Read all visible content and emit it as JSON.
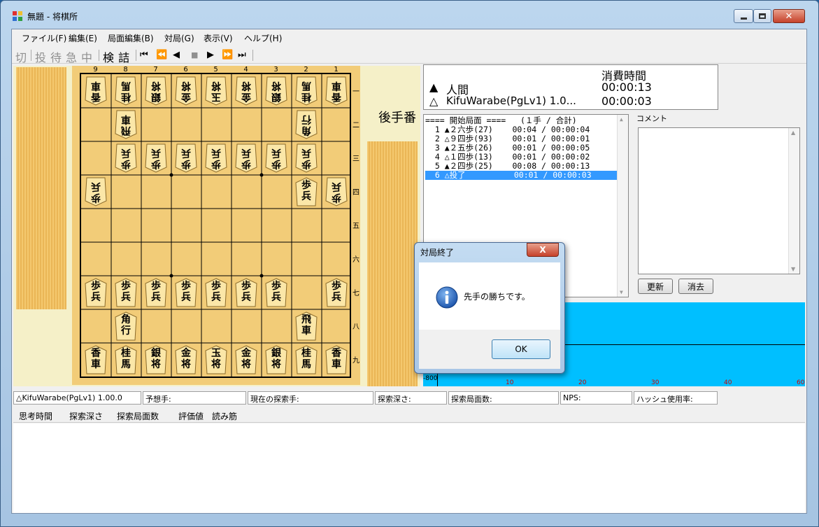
{
  "window": {
    "title": "無題 - 将棋所"
  },
  "menu": [
    "ファイル(F)",
    "編集(E)",
    "局面編集(B)",
    "対局(G)",
    "表示(V)",
    "ヘルプ(H)"
  ],
  "toolbar": {
    "items": [
      "切",
      "投",
      "待",
      "急",
      "中",
      "検",
      "詰"
    ],
    "nav": [
      "⏮",
      "⏪",
      "◀",
      "■",
      "▶",
      "⏩",
      "⏭"
    ]
  },
  "board": {
    "col_numbers": [
      "9",
      "8",
      "7",
      "6",
      "5",
      "4",
      "3",
      "2",
      "1"
    ],
    "row_numbers": [
      "一",
      "二",
      "三",
      "四",
      "五",
      "六",
      "七",
      "八",
      "九"
    ],
    "pieces": [
      {
        "r": 0,
        "c": 0,
        "t": "香車",
        "g": true
      },
      {
        "r": 0,
        "c": 1,
        "t": "桂馬",
        "g": true
      },
      {
        "r": 0,
        "c": 2,
        "t": "銀将",
        "g": true
      },
      {
        "r": 0,
        "c": 3,
        "t": "金将",
        "g": true
      },
      {
        "r": 0,
        "c": 4,
        "t": "玉将",
        "g": true
      },
      {
        "r": 0,
        "c": 5,
        "t": "金将",
        "g": true
      },
      {
        "r": 0,
        "c": 6,
        "t": "銀将",
        "g": true
      },
      {
        "r": 0,
        "c": 7,
        "t": "桂馬",
        "g": true
      },
      {
        "r": 0,
        "c": 8,
        "t": "香車",
        "g": true
      },
      {
        "r": 1,
        "c": 1,
        "t": "飛車",
        "g": true
      },
      {
        "r": 1,
        "c": 7,
        "t": "角行",
        "g": true
      },
      {
        "r": 2,
        "c": 1,
        "t": "歩兵",
        "g": true
      },
      {
        "r": 2,
        "c": 2,
        "t": "歩兵",
        "g": true
      },
      {
        "r": 2,
        "c": 3,
        "t": "歩兵",
        "g": true
      },
      {
        "r": 2,
        "c": 4,
        "t": "歩兵",
        "g": true
      },
      {
        "r": 2,
        "c": 5,
        "t": "歩兵",
        "g": true
      },
      {
        "r": 2,
        "c": 6,
        "t": "歩兵",
        "g": true
      },
      {
        "r": 2,
        "c": 7,
        "t": "歩兵",
        "g": true
      },
      {
        "r": 3,
        "c": 0,
        "t": "歩兵",
        "g": true
      },
      {
        "r": 3,
        "c": 7,
        "t": "歩兵",
        "g": false
      },
      {
        "r": 3,
        "c": 8,
        "t": "歩兵",
        "g": true
      },
      {
        "r": 6,
        "c": 0,
        "t": "歩兵",
        "g": false
      },
      {
        "r": 6,
        "c": 1,
        "t": "歩兵",
        "g": false
      },
      {
        "r": 6,
        "c": 2,
        "t": "歩兵",
        "g": false
      },
      {
        "r": 6,
        "c": 3,
        "t": "歩兵",
        "g": false
      },
      {
        "r": 6,
        "c": 4,
        "t": "歩兵",
        "g": false
      },
      {
        "r": 6,
        "c": 5,
        "t": "歩兵",
        "g": false
      },
      {
        "r": 6,
        "c": 6,
        "t": "歩兵",
        "g": false
      },
      {
        "r": 6,
        "c": 8,
        "t": "歩兵",
        "g": false
      },
      {
        "r": 7,
        "c": 1,
        "t": "角行",
        "g": false
      },
      {
        "r": 7,
        "c": 7,
        "t": "飛車",
        "g": false
      },
      {
        "r": 8,
        "c": 0,
        "t": "香車",
        "g": false
      },
      {
        "r": 8,
        "c": 1,
        "t": "桂馬",
        "g": false
      },
      {
        "r": 8,
        "c": 2,
        "t": "銀将",
        "g": false
      },
      {
        "r": 8,
        "c": 3,
        "t": "金将",
        "g": false
      },
      {
        "r": 8,
        "c": 4,
        "t": "玉将",
        "g": false
      },
      {
        "r": 8,
        "c": 5,
        "t": "金将",
        "g": false
      },
      {
        "r": 8,
        "c": 6,
        "t": "銀将",
        "g": false
      },
      {
        "r": 8,
        "c": 7,
        "t": "桂馬",
        "g": false
      },
      {
        "r": 8,
        "c": 8,
        "t": "香車",
        "g": false
      }
    ],
    "turn_label": "後手番"
  },
  "time": {
    "header": "消費時間",
    "sente": {
      "mark": "▲",
      "name": "人間",
      "time": "00:00:13"
    },
    "gote": {
      "mark": "△",
      "name": "KifuWarabe(PgLv1) 1.0...",
      "time": "00:00:03"
    }
  },
  "kifu": {
    "header": "==== 開始局面 ====   (１手 / 合計)",
    "moves": [
      "  1 ▲２六歩(27)    00:04 / 00:00:04",
      "  2 △９四歩(93)    00:01 / 00:00:01",
      "  3 ▲２五歩(26)    00:01 / 00:00:05",
      "  4 △１四歩(13)    00:01 / 00:00:02",
      "  5 ▲２四歩(25)    00:08 / 00:00:13",
      "  6 △投了          00:01 / 00:00:03"
    ],
    "selected_index": 5
  },
  "comment": {
    "label": "コメント",
    "update_button": "更新",
    "clear_button": "消去"
  },
  "graph": {
    "ticks": [
      "-800",
      "10",
      "20",
      "30",
      "40",
      "60"
    ]
  },
  "status": {
    "engine": "△KifuWarabe(PgLv1) 1.00.0",
    "predict": "予想手:",
    "current": "現在の探索手:",
    "depth": "探索深さ:",
    "nodes": "探索局面数:",
    "nps": "NPS:",
    "hash": "ハッシュ使用率:"
  },
  "think": {
    "headers": [
      "思考時間",
      "探索深さ",
      "探索局面数",
      "評価値",
      "読み筋"
    ]
  },
  "dialog": {
    "title": "対局終了",
    "message": "先手の勝ちです。",
    "ok": "OK",
    "close": "X"
  }
}
